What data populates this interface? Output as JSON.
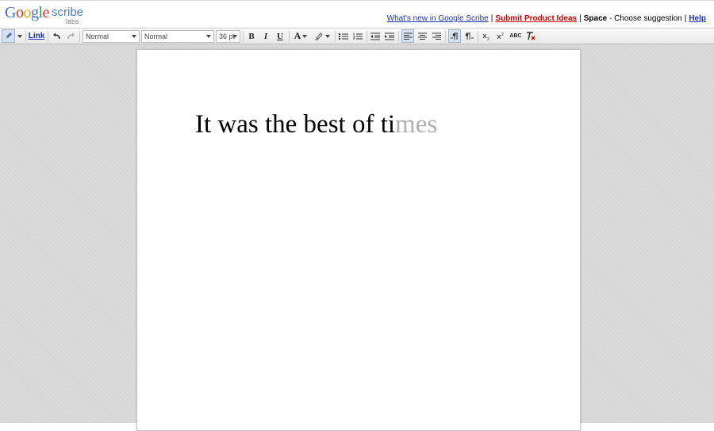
{
  "header": {
    "logo": {
      "google_letters": [
        {
          "ch": "G",
          "color": "#3a6fd8"
        },
        {
          "ch": "o",
          "color": "#d93025"
        },
        {
          "ch": "o",
          "color": "#e8a600"
        },
        {
          "ch": "g",
          "color": "#3a6fd8"
        },
        {
          "ch": "l",
          "color": "#2e9a3c"
        },
        {
          "ch": "e",
          "color": "#d93025"
        }
      ],
      "product": "scribe",
      "badge": "labs"
    },
    "links": {
      "whats_new": "What's new in Google Scribe",
      "submit_ideas": "Submit Product Ideas",
      "hint_key": "Space",
      "hint_text": " - Choose suggestion",
      "help": "Help",
      "separator": "|"
    }
  },
  "toolbar": {
    "link_label": "Link",
    "style_select": "Normal",
    "font_select": "Normal",
    "size_select": "36 pt",
    "bold": "B",
    "italic": "I",
    "underline": "U",
    "text_color": "A",
    "spellcheck": "ABC",
    "icons": [
      "pencil-icon",
      "undo-icon",
      "redo-icon",
      "bold-icon",
      "italic-icon",
      "underline-icon",
      "text-color-icon",
      "highlight-icon",
      "bullet-list-icon",
      "numbered-list-icon",
      "outdent-icon",
      "indent-icon",
      "align-left-icon",
      "align-center-icon",
      "align-right-icon",
      "ltr-icon",
      "rtl-icon",
      "subscript-icon",
      "superscript-icon",
      "spellcheck-icon",
      "clear-format-icon"
    ]
  },
  "document": {
    "typed_text": "It was the best of ti",
    "suggestion_text": "mes"
  },
  "colors": {
    "link_blue": "#1a31b8",
    "link_red": "#cc0000",
    "suggestion_gray": "#b0b0b0",
    "workspace_bg": "#d7d7d7"
  }
}
